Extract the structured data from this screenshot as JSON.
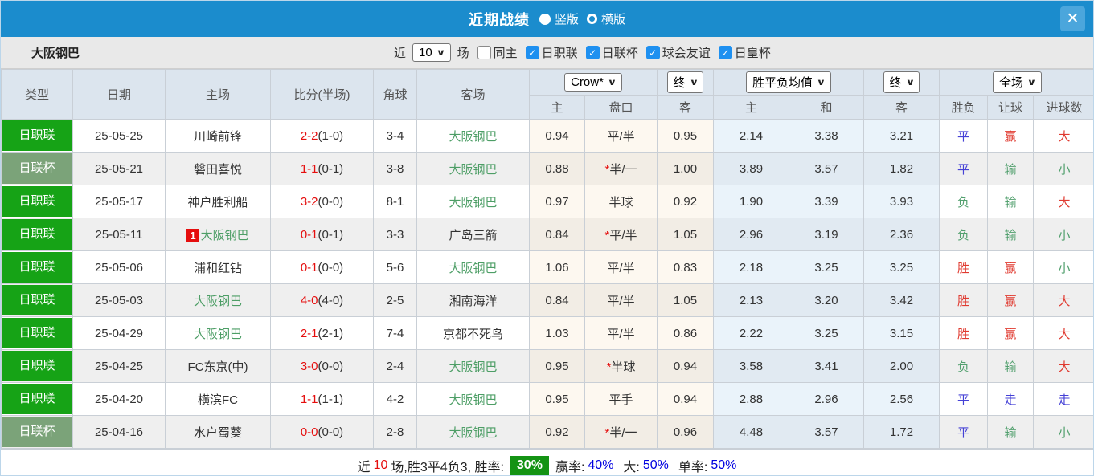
{
  "icons": {
    "close": "✕",
    "chevron_down": "∨",
    "check": "✓"
  },
  "titlebar": {
    "title": "近期战绩",
    "vertical_label": "竖版",
    "horizontal_label": "横版"
  },
  "toolbar": {
    "team": "大阪钢巴",
    "near_label": "近",
    "count_value": "10",
    "matches_label": "场",
    "same_home_label": "同主",
    "filters": [
      {
        "label": "日职联",
        "checked": true
      },
      {
        "label": "日联杯",
        "checked": true
      },
      {
        "label": "球会友谊",
        "checked": true
      },
      {
        "label": "日皇杯",
        "checked": true
      }
    ]
  },
  "table": {
    "columns": {
      "type": "类型",
      "date": "日期",
      "home": "主场",
      "score": "比分(半场)",
      "corners": "角球",
      "away": "客场"
    },
    "dropdowns": {
      "company": "Crow*",
      "company_period": "终",
      "avg": "胜平负均值",
      "avg_period": "终",
      "scope": "全场"
    },
    "subcolumns": {
      "h_home": "主",
      "h_line": "盘口",
      "h_away": "客",
      "o_home": "主",
      "o_draw": "和",
      "o_away": "客",
      "r_wdl": "胜负",
      "r_handicap": "让球",
      "r_goals": "进球数"
    },
    "rows": [
      {
        "league": "日职联",
        "league_class": "lg-j1",
        "date": "25-05-25",
        "rank": "",
        "home": "川崎前锋",
        "home_class": "",
        "score": "2-2",
        "half": "(1-0)",
        "corners": "3-4",
        "away": "大阪钢巴",
        "away_class": "self",
        "hcap_star": "",
        "hcap_home": "0.94",
        "hcap": "平/半",
        "hcap_away": "0.95",
        "odds_home": "2.14",
        "odds_draw": "3.38",
        "odds_away": "3.21",
        "result": "平",
        "result_class": "blue",
        "hres": "赢",
        "hres_class": "red",
        "gres": "大",
        "gres_class": "red"
      },
      {
        "league": "日联杯",
        "league_class": "lg-cup",
        "date": "25-05-21",
        "rank": "",
        "home": "磐田喜悦",
        "home_class": "",
        "score": "1-1",
        "half": "(0-1)",
        "corners": "3-8",
        "away": "大阪钢巴",
        "away_class": "self",
        "hcap_star": "*",
        "hcap_home": "0.88",
        "hcap": "半/一",
        "hcap_away": "1.00",
        "odds_home": "3.89",
        "odds_draw": "3.57",
        "odds_away": "1.82",
        "result": "平",
        "result_class": "blue",
        "hres": "输",
        "hres_class": "green",
        "gres": "小",
        "gres_class": "green"
      },
      {
        "league": "日职联",
        "league_class": "lg-j1",
        "date": "25-05-17",
        "rank": "",
        "home": "神户胜利船",
        "home_class": "",
        "score": "3-2",
        "half": "(0-0)",
        "corners": "8-1",
        "away": "大阪钢巴",
        "away_class": "self",
        "hcap_star": "",
        "hcap_home": "0.97",
        "hcap": "半球",
        "hcap_away": "0.92",
        "odds_home": "1.90",
        "odds_draw": "3.39",
        "odds_away": "3.93",
        "result": "负",
        "result_class": "green",
        "hres": "输",
        "hres_class": "green",
        "gres": "大",
        "gres_class": "red"
      },
      {
        "league": "日职联",
        "league_class": "lg-j1",
        "date": "25-05-11",
        "rank": "1",
        "home": "大阪钢巴",
        "home_class": "self",
        "score": "0-1",
        "half": "(0-1)",
        "corners": "3-3",
        "away": "广岛三箭",
        "away_class": "",
        "hcap_star": "*",
        "hcap_home": "0.84",
        "hcap": "平/半",
        "hcap_away": "1.05",
        "odds_home": "2.96",
        "odds_draw": "3.19",
        "odds_away": "2.36",
        "result": "负",
        "result_class": "green",
        "hres": "输",
        "hres_class": "green",
        "gres": "小",
        "gres_class": "green"
      },
      {
        "league": "日职联",
        "league_class": "lg-j1",
        "date": "25-05-06",
        "rank": "",
        "home": "浦和红钻",
        "home_class": "",
        "score": "0-1",
        "half": "(0-0)",
        "corners": "5-6",
        "away": "大阪钢巴",
        "away_class": "self",
        "hcap_star": "",
        "hcap_home": "1.06",
        "hcap": "平/半",
        "hcap_away": "0.83",
        "odds_home": "2.18",
        "odds_draw": "3.25",
        "odds_away": "3.25",
        "result": "胜",
        "result_class": "red",
        "hres": "赢",
        "hres_class": "red",
        "gres": "小",
        "gres_class": "green"
      },
      {
        "league": "日职联",
        "league_class": "lg-j1",
        "date": "25-05-03",
        "rank": "",
        "home": "大阪钢巴",
        "home_class": "self",
        "score": "4-0",
        "half": "(4-0)",
        "corners": "2-5",
        "away": "湘南海洋",
        "away_class": "",
        "hcap_star": "",
        "hcap_home": "0.84",
        "hcap": "平/半",
        "hcap_away": "1.05",
        "odds_home": "2.13",
        "odds_draw": "3.20",
        "odds_away": "3.42",
        "result": "胜",
        "result_class": "red",
        "hres": "赢",
        "hres_class": "red",
        "gres": "大",
        "gres_class": "red"
      },
      {
        "league": "日职联",
        "league_class": "lg-j1",
        "date": "25-04-29",
        "rank": "",
        "home": "大阪钢巴",
        "home_class": "self",
        "score": "2-1",
        "half": "(2-1)",
        "corners": "7-4",
        "away": "京都不死鸟",
        "away_class": "",
        "hcap_star": "",
        "hcap_home": "1.03",
        "hcap": "平/半",
        "hcap_away": "0.86",
        "odds_home": "2.22",
        "odds_draw": "3.25",
        "odds_away": "3.15",
        "result": "胜",
        "result_class": "red",
        "hres": "赢",
        "hres_class": "red",
        "gres": "大",
        "gres_class": "red"
      },
      {
        "league": "日职联",
        "league_class": "lg-j1",
        "date": "25-04-25",
        "rank": "",
        "home": "FC东京(中)",
        "home_class": "",
        "score": "3-0",
        "half": "(0-0)",
        "corners": "2-4",
        "away": "大阪钢巴",
        "away_class": "self",
        "hcap_star": "*",
        "hcap_home": "0.95",
        "hcap": "半球",
        "hcap_away": "0.94",
        "odds_home": "3.58",
        "odds_draw": "3.41",
        "odds_away": "2.00",
        "result": "负",
        "result_class": "green",
        "hres": "输",
        "hres_class": "green",
        "gres": "大",
        "gres_class": "red"
      },
      {
        "league": "日职联",
        "league_class": "lg-j1",
        "date": "25-04-20",
        "rank": "",
        "home": "横滨FC",
        "home_class": "",
        "score": "1-1",
        "half": "(1-1)",
        "corners": "4-2",
        "away": "大阪钢巴",
        "away_class": "self",
        "hcap_star": "",
        "hcap_home": "0.95",
        "hcap": "平手",
        "hcap_away": "0.94",
        "odds_home": "2.88",
        "odds_draw": "2.96",
        "odds_away": "2.56",
        "result": "平",
        "result_class": "blue",
        "hres": "走",
        "hres_class": "blue",
        "gres": "走",
        "gres_class": "blue"
      },
      {
        "league": "日联杯",
        "league_class": "lg-cup",
        "date": "25-04-16",
        "rank": "",
        "home": "水户蜀葵",
        "home_class": "",
        "score": "0-0",
        "half": "(0-0)",
        "corners": "2-8",
        "away": "大阪钢巴",
        "away_class": "self",
        "hcap_star": "*",
        "hcap_home": "0.92",
        "hcap": "半/一",
        "hcap_away": "0.96",
        "odds_home": "4.48",
        "odds_draw": "3.57",
        "odds_away": "1.72",
        "result": "平",
        "result_class": "blue",
        "hres": "输",
        "hres_class": "green",
        "gres": "小",
        "gres_class": "green"
      }
    ]
  },
  "summary": {
    "prefix": "近",
    "count": "10",
    "mid": "场,胜3平4负3, 胜率:",
    "win_rate": "30%",
    "seg2_label": "赢率:",
    "seg2_value": "40%",
    "seg3_label": "大:",
    "seg3_value": "50%",
    "seg4_label": "单率:",
    "seg4_value": "50%"
  }
}
